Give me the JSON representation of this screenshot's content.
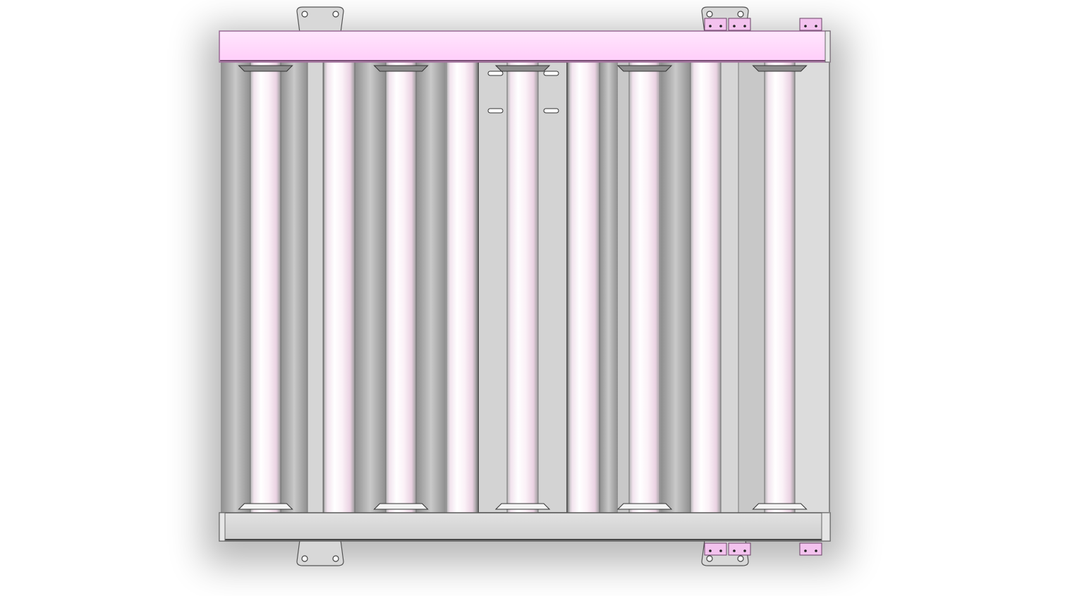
{
  "view": {
    "subject": "roller-conveyor-top-view",
    "background": "#ffffff"
  },
  "colors": {
    "top_frame": "#ffd4fb",
    "top_frame_edge": "#9a6a95",
    "bottom_frame": "#d7d7d7",
    "frame_edge": "#5a5a5a",
    "side_gap": "#d6d6d6",
    "center_plate": "#d3d3d3",
    "roller_light": "#ffffff",
    "roller_pink": "#f0dcea",
    "roller_shadow": "#9a9a9a",
    "bracket": "#d8d8d8",
    "clip": "#f3c2ee"
  },
  "counts": {
    "rollers": 9,
    "flanged_rollers": 5,
    "mount_brackets": 4,
    "clips_per_side": 3,
    "slots": 4
  },
  "icons": {
    "bracket": "mount-bracket-icon",
    "clip": "clip-icon",
    "slot": "slot-icon"
  }
}
